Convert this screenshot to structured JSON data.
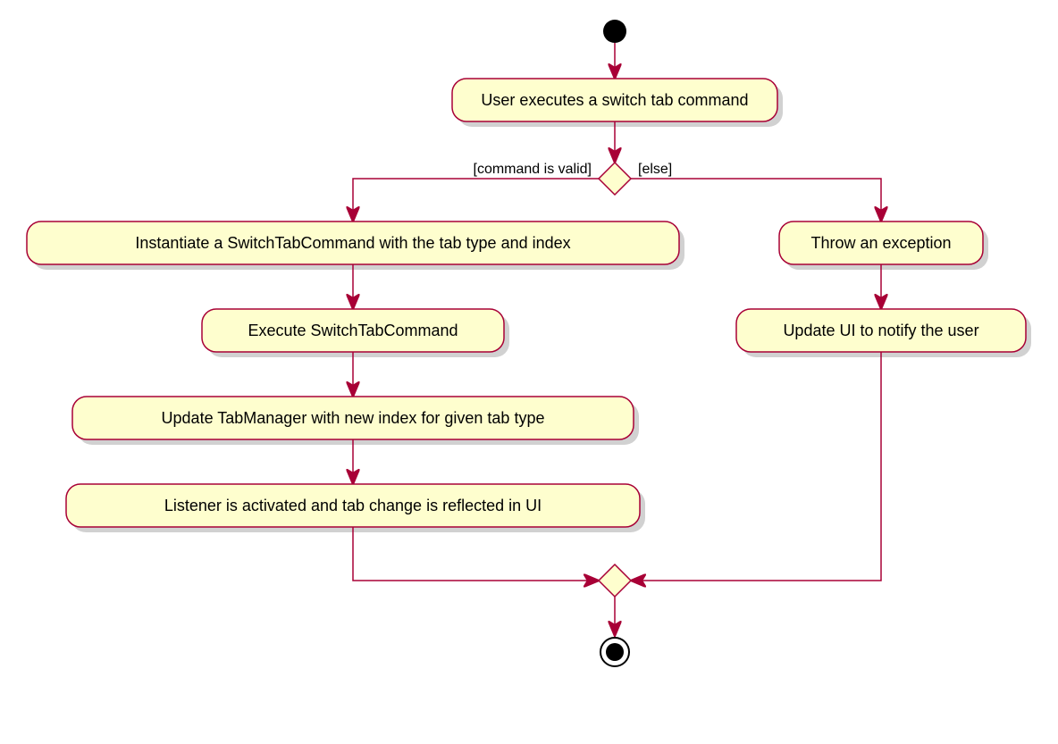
{
  "chart_data": {
    "type": "activity-diagram",
    "start": "initial",
    "end": "final",
    "nodes": [
      {
        "id": "initial",
        "type": "initial"
      },
      {
        "id": "n1",
        "type": "action",
        "label": "User executes a switch tab command"
      },
      {
        "id": "d1",
        "type": "decision",
        "left_guard": "[command is valid]",
        "right_guard": "[else]"
      },
      {
        "id": "n2",
        "type": "action",
        "label": "Instantiate a SwitchTabCommand with the tab type and index"
      },
      {
        "id": "n3",
        "type": "action",
        "label": "Execute SwitchTabCommand"
      },
      {
        "id": "n4",
        "type": "action",
        "label": "Update TabManager with new index for given tab type"
      },
      {
        "id": "n5",
        "type": "action",
        "label": "Listener is activated and tab change is reflected in UI"
      },
      {
        "id": "n6",
        "type": "action",
        "label": "Throw an exception"
      },
      {
        "id": "n7",
        "type": "action",
        "label": "Update UI to notify the user"
      },
      {
        "id": "m1",
        "type": "merge"
      },
      {
        "id": "final",
        "type": "final"
      }
    ],
    "edges": [
      {
        "from": "initial",
        "to": "n1"
      },
      {
        "from": "n1",
        "to": "d1"
      },
      {
        "from": "d1",
        "to": "n2",
        "guard": "[command is valid]"
      },
      {
        "from": "d1",
        "to": "n6",
        "guard": "[else]"
      },
      {
        "from": "n2",
        "to": "n3"
      },
      {
        "from": "n3",
        "to": "n4"
      },
      {
        "from": "n4",
        "to": "n5"
      },
      {
        "from": "n5",
        "to": "m1"
      },
      {
        "from": "n6",
        "to": "n7"
      },
      {
        "from": "n7",
        "to": "m1"
      },
      {
        "from": "m1",
        "to": "final"
      }
    ]
  }
}
